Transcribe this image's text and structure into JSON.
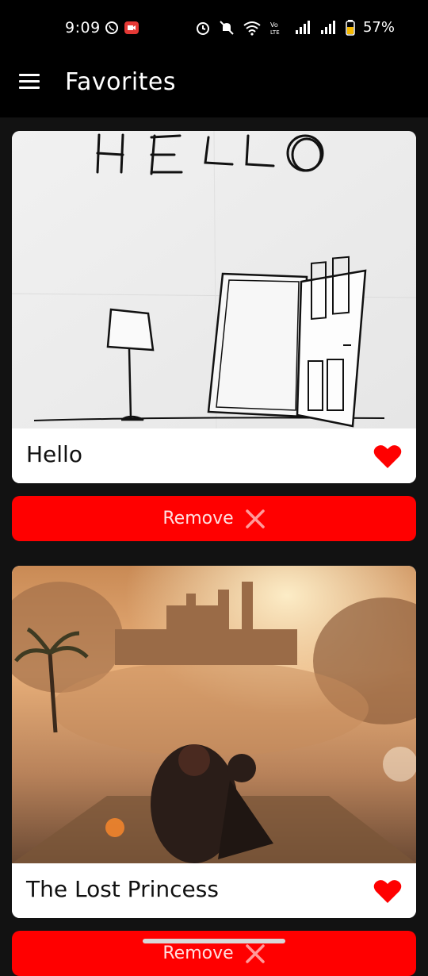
{
  "status_bar": {
    "time": "9:09",
    "battery": "57%",
    "icons": [
      "whatsapp-icon",
      "screen-record-icon",
      "alarm-icon",
      "mute-icon",
      "wifi-icon",
      "volte-icon",
      "signal-icon",
      "signal-icon",
      "battery-icon"
    ]
  },
  "app_bar": {
    "title": "Favorites",
    "menu_icon": "hamburger-menu-icon"
  },
  "favorites": [
    {
      "title": "Hello",
      "favorite": true,
      "remove_label": "Remove"
    },
    {
      "title": "The Lost Princess",
      "favorite": true,
      "remove_label": "Remove"
    }
  ],
  "colors": {
    "accent": "#ff0000",
    "background": "#121212",
    "bar": "#000000"
  }
}
